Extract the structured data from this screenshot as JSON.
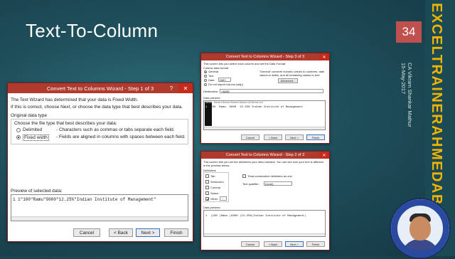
{
  "slide": {
    "title": "Text-To-Column",
    "page_number": "34",
    "brand": "EXCELTRAINERAHMEDABAD",
    "presenter_line1": "CA Vikram Shankar Mathur",
    "presenter_line2": "15-May-2017",
    "photo_caption": "CA Vikram Shankar Mathur | excel"
  },
  "dialog_main": {
    "title": "Convert Text to Columns Wizard - Step 1 of 3",
    "help": "?",
    "close": "✕",
    "line1": "The Text Wizard has determined that your data is Fixed Width.",
    "line2": "If this is correct, choose Next, or choose the data type that best describes your data.",
    "group_label": "Original data type",
    "choose_label": "Choose the file type that best describes your data:",
    "option_delimited": "Delimited",
    "option_delimited_desc": "- Characters such as commas or tabs separate each field.",
    "option_fixed": "Fixed width",
    "option_fixed_desc": "- Fields are aligned in columns with spaces between each field.",
    "preview_label": "Preview of selected data:",
    "preview_row_num": "1",
    "preview_row": "1\"100\"Ramu\"9000\"12.25%\"Indian Institute of Management\"",
    "btn_cancel": "Cancel",
    "btn_back": "< Back",
    "btn_next": "Next >",
    "btn_finish": "Finish"
  },
  "dialog_top_right": {
    "title": "Convert Text to Columns Wizard - Step 3 of 3",
    "intro": "This screen lets you select each column and set the Data Format.",
    "group_label": "Column data format",
    "opt_general": "General",
    "opt_text": "Text",
    "opt_date": "Date:",
    "date_value": "DMY",
    "opt_skip": "Do not import column (skip)",
    "info": "'General' converts numeric values to numbers, date values to dates, and all remaining values to text.",
    "advanced": "Advanced...",
    "destination_label": "Destination:",
    "destination_value": "=$A$6",
    "preview_label": "Data preview",
    "preview_header": [
      "Gener",
      "Gener",
      "Gener",
      "Gener",
      "General",
      "General"
    ],
    "preview_row": [
      "1",
      "100",
      "Ramu",
      "9000",
      "12.25%",
      "Indian Institute of Management"
    ],
    "btn_cancel": "Cancel",
    "btn_back": "< Back",
    "btn_next": "Next >",
    "btn_finish": "Finish"
  },
  "dialog_bottom_right": {
    "title": "Convert Text to Columns Wizard - Step 2 of 3",
    "intro": "This screen lets you set the delimiters your data contains. You can see how your text is affected in the preview below.",
    "delimiters_label": "Delimiters",
    "opt_tab": "Tab",
    "opt_semicolon": "Semicolon",
    "opt_comma": "Comma",
    "opt_space": "Space",
    "opt_other": "Other:",
    "other_value": "\"",
    "consecutive": "Treat consecutive delimiters as one",
    "qualifier_label": "Text qualifier:",
    "qualifier_value": "{none}",
    "preview_label": "Data preview",
    "preview_row": [
      "1",
      "100",
      "Ramu",
      "9000",
      "12.25%",
      "Indian Institute of Management"
    ],
    "btn_cancel": "Cancel",
    "btn_back": "< Back",
    "btn_next": "Next >",
    "btn_finish": "Finish"
  },
  "colors": {
    "background": "#1f4f5b",
    "title_bar": "#b03a2e",
    "page_badge": "#c0504d",
    "brand_text": "#f0b400"
  }
}
